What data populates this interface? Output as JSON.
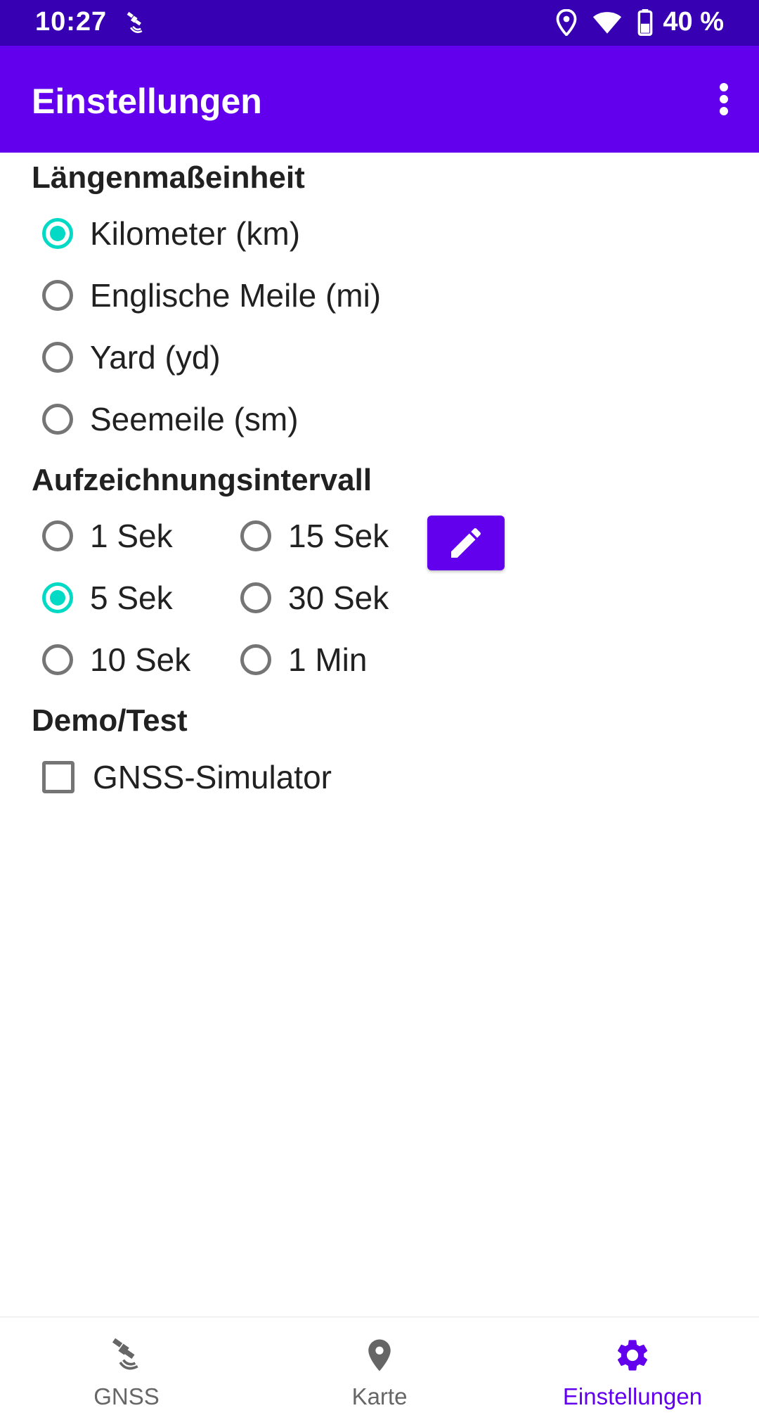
{
  "status_bar": {
    "time": "10:27",
    "battery_text": "40 %",
    "icons": [
      "satellite-icon",
      "location-icon",
      "wifi-icon",
      "battery-icon"
    ]
  },
  "app_bar": {
    "title": "Einstellungen",
    "menu_icon": "more-vert-icon"
  },
  "length_unit": {
    "title": "Längenmaßeinheit",
    "options": [
      {
        "label": "Kilometer (km)",
        "checked": true
      },
      {
        "label": "Englische Meile (mi)",
        "checked": false
      },
      {
        "label": "Yard (yd)",
        "checked": false
      },
      {
        "label": "Seemeile (sm)",
        "checked": false
      }
    ]
  },
  "interval": {
    "title": "Aufzeichnungsintervall",
    "options": [
      {
        "label": "1 Sek",
        "checked": false
      },
      {
        "label": "15 Sek",
        "checked": false
      },
      {
        "label": "5 Sek",
        "checked": true
      },
      {
        "label": "30 Sek",
        "checked": false
      },
      {
        "label": "10 Sek",
        "checked": false
      },
      {
        "label": "1 Min",
        "checked": false
      }
    ],
    "edit_icon": "pencil-icon"
  },
  "demo": {
    "title": "Demo/Test",
    "simulator_label": "GNSS-Simulator",
    "simulator_checked": false
  },
  "bottom_nav": {
    "items": [
      {
        "label": "GNSS",
        "icon": "satellite-icon",
        "active": false
      },
      {
        "label": "Karte",
        "icon": "map-pin-icon",
        "active": false
      },
      {
        "label": "Einstellungen",
        "icon": "gear-icon",
        "active": true
      }
    ]
  },
  "colors": {
    "primary": "#6200ee",
    "primary_dark": "#3700b3",
    "accent": "#03dac5"
  }
}
